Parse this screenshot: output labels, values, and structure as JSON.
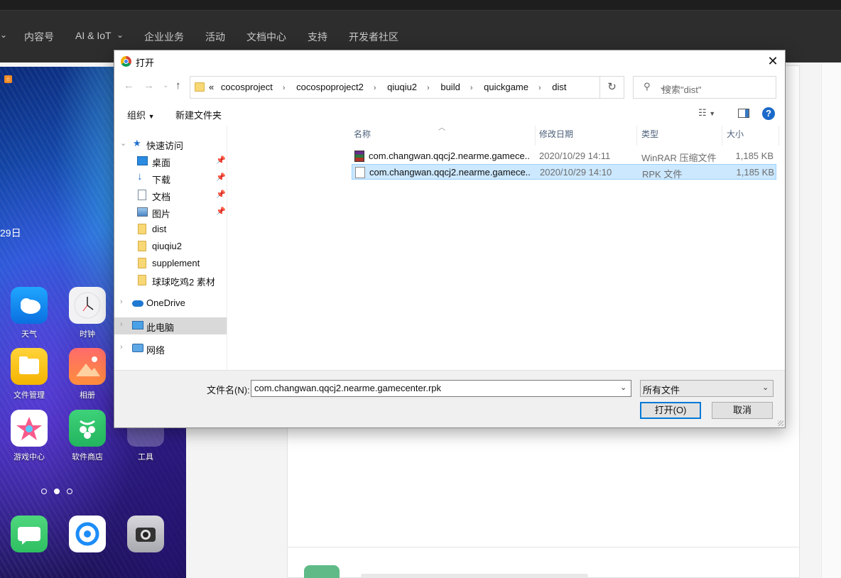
{
  "site": {
    "nav": [
      "内容号",
      "AI & IoT",
      "企业业务",
      "活动",
      "文档中心",
      "支持",
      "开发者社区"
    ]
  },
  "phone": {
    "date_partial": "29日",
    "apps": [
      {
        "label": "天气",
        "icon": "weather-icon"
      },
      {
        "label": "时钟",
        "icon": "clock-icon"
      },
      {
        "label": "文件管理",
        "icon": "file-manager-icon"
      },
      {
        "label": "相册",
        "icon": "gallery-icon"
      },
      {
        "label": "游戏中心",
        "icon": "game-center-icon"
      },
      {
        "label": "软件商店",
        "icon": "app-store-icon"
      },
      {
        "label": "工具",
        "icon": "tools-icon"
      }
    ]
  },
  "dialog": {
    "title": "打开",
    "close": "✕",
    "address": {
      "overflow": "«",
      "crumbs": [
        "cocosproject",
        "cocospoproject2",
        "qiuqiu2",
        "build",
        "quickgame",
        "dist"
      ]
    },
    "search_placeholder": "搜索\"dist\"",
    "toolbar": {
      "organize": "组织",
      "new_folder": "新建文件夹"
    },
    "nav": {
      "quick_access": "快速访问",
      "items": [
        {
          "label": "桌面",
          "pinned": true
        },
        {
          "label": "下载",
          "pinned": true
        },
        {
          "label": "文档",
          "pinned": true
        },
        {
          "label": "图片",
          "pinned": true
        },
        {
          "label": "dist",
          "pinned": false
        },
        {
          "label": "qiuqiu2",
          "pinned": false
        },
        {
          "label": "supplement",
          "pinned": false
        },
        {
          "label": "球球吃鸡2 素材",
          "pinned": false
        }
      ],
      "onedrive": "OneDrive",
      "this_pc": "此电脑",
      "network": "网络"
    },
    "columns": {
      "name": "名称",
      "modified": "修改日期",
      "type": "类型",
      "size": "大小"
    },
    "files": [
      {
        "name": "com.changwan.qqcj2.nearme.gamece...",
        "modified": "2020/10/29 14:11",
        "type": "WinRAR 压缩文件",
        "size": "1,185 KB",
        "selected": false
      },
      {
        "name": "com.changwan.qqcj2.nearme.gamece...",
        "modified": "2020/10/29 14:10",
        "type": "RPK 文件",
        "size": "1,185 KB",
        "selected": true
      }
    ],
    "filename_label": "文件名(N):",
    "filename_value": "com.changwan.qqcj2.nearme.gamecenter.rpk",
    "filetype_value": "所有文件",
    "open_button": "打开(O)",
    "cancel_button": "取消"
  }
}
